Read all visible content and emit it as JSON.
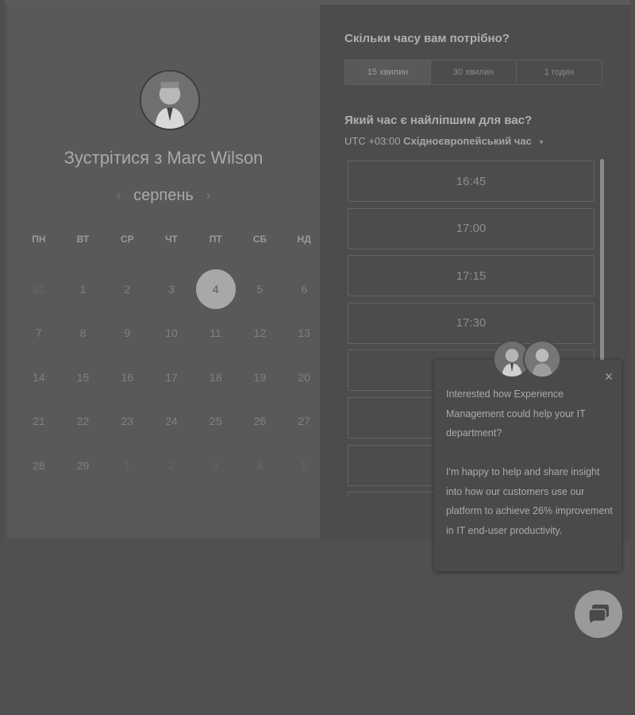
{
  "calendar": {
    "title": "Зустрітися з Marc Wilson",
    "month": "серпень",
    "prev_arrow": "‹",
    "next_arrow": "›",
    "weekdays": [
      "ПН",
      "ВТ",
      "СР",
      "ЧТ",
      "ПТ",
      "СБ",
      "НД"
    ],
    "days": [
      {
        "label": "31",
        "state": "muted"
      },
      {
        "label": "1",
        "state": "normal"
      },
      {
        "label": "2",
        "state": "normal"
      },
      {
        "label": "3",
        "state": "normal"
      },
      {
        "label": "4",
        "state": "selected"
      },
      {
        "label": "5",
        "state": "normal"
      },
      {
        "label": "6",
        "state": "normal"
      },
      {
        "label": "7",
        "state": "normal"
      },
      {
        "label": "8",
        "state": "normal"
      },
      {
        "label": "9",
        "state": "normal"
      },
      {
        "label": "10",
        "state": "normal"
      },
      {
        "label": "11",
        "state": "normal"
      },
      {
        "label": "12",
        "state": "normal"
      },
      {
        "label": "13",
        "state": "normal"
      },
      {
        "label": "14",
        "state": "normal"
      },
      {
        "label": "15",
        "state": "normal"
      },
      {
        "label": "16",
        "state": "normal"
      },
      {
        "label": "17",
        "state": "normal"
      },
      {
        "label": "18",
        "state": "normal"
      },
      {
        "label": "19",
        "state": "normal"
      },
      {
        "label": "20",
        "state": "normal"
      },
      {
        "label": "21",
        "state": "normal"
      },
      {
        "label": "22",
        "state": "normal"
      },
      {
        "label": "23",
        "state": "normal"
      },
      {
        "label": "24",
        "state": "normal"
      },
      {
        "label": "25",
        "state": "normal"
      },
      {
        "label": "26",
        "state": "normal"
      },
      {
        "label": "27",
        "state": "normal"
      },
      {
        "label": "28",
        "state": "normal"
      },
      {
        "label": "29",
        "state": "normal"
      },
      {
        "label": "1",
        "state": "muted"
      },
      {
        "label": "2",
        "state": "muted"
      },
      {
        "label": "3",
        "state": "muted"
      },
      {
        "label": "4",
        "state": "muted"
      },
      {
        "label": "5",
        "state": "muted"
      }
    ]
  },
  "duration": {
    "title": "Скільки часу вам потрібно?",
    "options": [
      "15 хвилин",
      "30 хвилин",
      "1 годин"
    ],
    "selected": "15 хвилин"
  },
  "times": {
    "title": "Який час є найліпшим для вас?",
    "timezone_offset": "UTC +03:00",
    "timezone_name": "Східноєвропейський час",
    "slots": [
      "16:45",
      "17:00",
      "17:15",
      "17:30",
      "",
      "",
      "",
      ""
    ]
  },
  "chat": {
    "close_label": "×",
    "message_paragraphs": [
      "Interested how Experience Management could help your IT department?",
      "I'm happy to help and share insight into how our customers use our platform to achieve 26% improvement in IT end-user productivity."
    ]
  },
  "colors": {
    "selected_day": "#a8a8a8",
    "left_panel": "#595959",
    "right_panel": "#4c4c4c"
  }
}
